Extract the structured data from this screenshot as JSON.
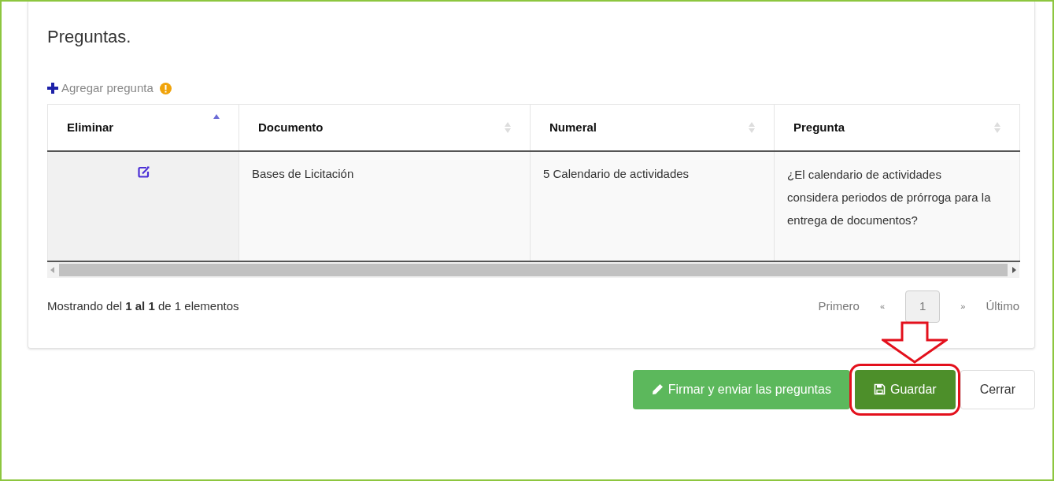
{
  "panel": {
    "title": "Preguntas.",
    "add_link": "Agregar pregunta"
  },
  "table": {
    "columns": [
      {
        "label": "Eliminar",
        "sorted": true
      },
      {
        "label": "Documento",
        "sorted": false
      },
      {
        "label": "Numeral",
        "sorted": false
      },
      {
        "label": "Pregunta",
        "sorted": false
      }
    ],
    "rows": [
      {
        "documento": "Bases de Licitación",
        "numeral": "5 Calendario de actividades",
        "pregunta": "¿El calendario de actividades considera periodos de prórroga para la entrega de documentos?"
      }
    ]
  },
  "info": "Mostrando del **1 al 1** de 1 elementos",
  "pagination": {
    "first": "Primero",
    "prev": "«",
    "pages": [
      {
        "label": "1",
        "selected": true
      }
    ],
    "next": "»",
    "last": "Último"
  },
  "buttons": [
    {
      "kind": "sign",
      "label": "Firmar y enviar las preguntas",
      "highlighted": false
    },
    {
      "kind": "save",
      "label": "Guardar",
      "highlighted": true
    },
    {
      "kind": "close",
      "label": "Cerrar",
      "highlighted": false
    }
  ]
}
